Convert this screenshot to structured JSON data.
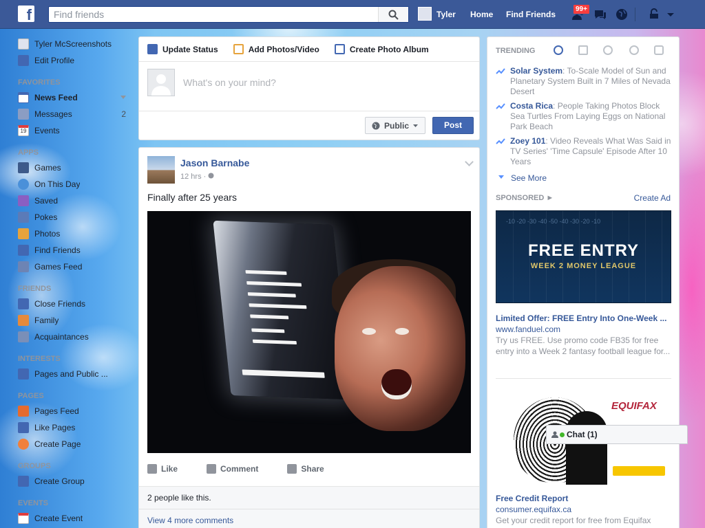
{
  "topbar": {
    "logo": "f",
    "search_placeholder": "Find friends",
    "user_name": "Tyler",
    "home_label": "Home",
    "find_friends_label": "Find Friends",
    "friend_requests_badge": "99+"
  },
  "left_nav": {
    "profile_name": "Tyler McScreenshots",
    "edit_profile": "Edit Profile",
    "favorites_header": "FAVORITES",
    "favorites": [
      {
        "label": "News Feed",
        "bold": true
      },
      {
        "label": "Messages",
        "count": "2"
      },
      {
        "label": "Events",
        "icon_text": "19"
      }
    ],
    "apps_header": "APPS",
    "apps": [
      "Games",
      "On This Day",
      "Saved",
      "Pokes",
      "Photos",
      "Find Friends",
      "Games Feed"
    ],
    "friends_header": "FRIENDS",
    "friends": [
      "Close Friends",
      "Family",
      "Acquaintances"
    ],
    "interests_header": "INTERESTS",
    "interests": [
      "Pages and Public ..."
    ],
    "pages_header": "PAGES",
    "pages": [
      "Pages Feed",
      "Like Pages",
      "Create Page"
    ],
    "groups_header": "GROUPS",
    "groups": [
      "Create Group"
    ],
    "events_header": "EVENTS",
    "events": [
      "Create Event"
    ]
  },
  "composer": {
    "tabs": [
      "Update Status",
      "Add Photos/Video",
      "Create Photo Album"
    ],
    "placeholder": "What's on your mind?",
    "privacy": "Public",
    "post_button": "Post"
  },
  "post": {
    "author": "Jason Barnabe",
    "time": "12 hrs",
    "text": "Finally after 25 years",
    "actions": [
      "Like",
      "Comment",
      "Share"
    ],
    "likes_text": "2 people like this.",
    "view_comments": "View 4 more comments"
  },
  "trending": {
    "header": "TRENDING",
    "items": [
      {
        "topic": "Solar System",
        "text": ": To-Scale Model of Sun and Planetary System Built in 7 Miles of Nevada Desert"
      },
      {
        "topic": "Costa Rica",
        "text": ": People Taking Photos Block Sea Turtles From Laying Eggs on National Park Beach"
      },
      {
        "topic": "Zoey 101",
        "text": ": Video Reveals What Was Said in TV Series' 'Time Capsule' Episode After 10 Years"
      }
    ],
    "see_more": "See More"
  },
  "sponsored": {
    "header": "SPONSORED",
    "create_ad": "Create Ad",
    "ads": [
      {
        "image_title": "FREE ENTRY",
        "image_subtitle": "WEEK 2 MONEY LEAGUE",
        "yard_marks": "-10 -20 -30 -40 -50 -40 -30 -20 -10",
        "title": "Limited Offer: FREE Entry Into One-Week ...",
        "url": "www.fanduel.com",
        "desc": "Try us FREE. Use promo code FB35 for free entry into a Week 2 fantasy football league for..."
      },
      {
        "image_brand": "EQUIFAX",
        "title": "Free Credit Report",
        "url": "consumer.equifax.ca",
        "desc": "Get your credit report for free from Equifax"
      }
    ]
  },
  "chat": {
    "label": "Chat (1)"
  },
  "colors": {
    "brand": "#3b5998",
    "link": "#365899",
    "post_button": "#4267b2"
  }
}
